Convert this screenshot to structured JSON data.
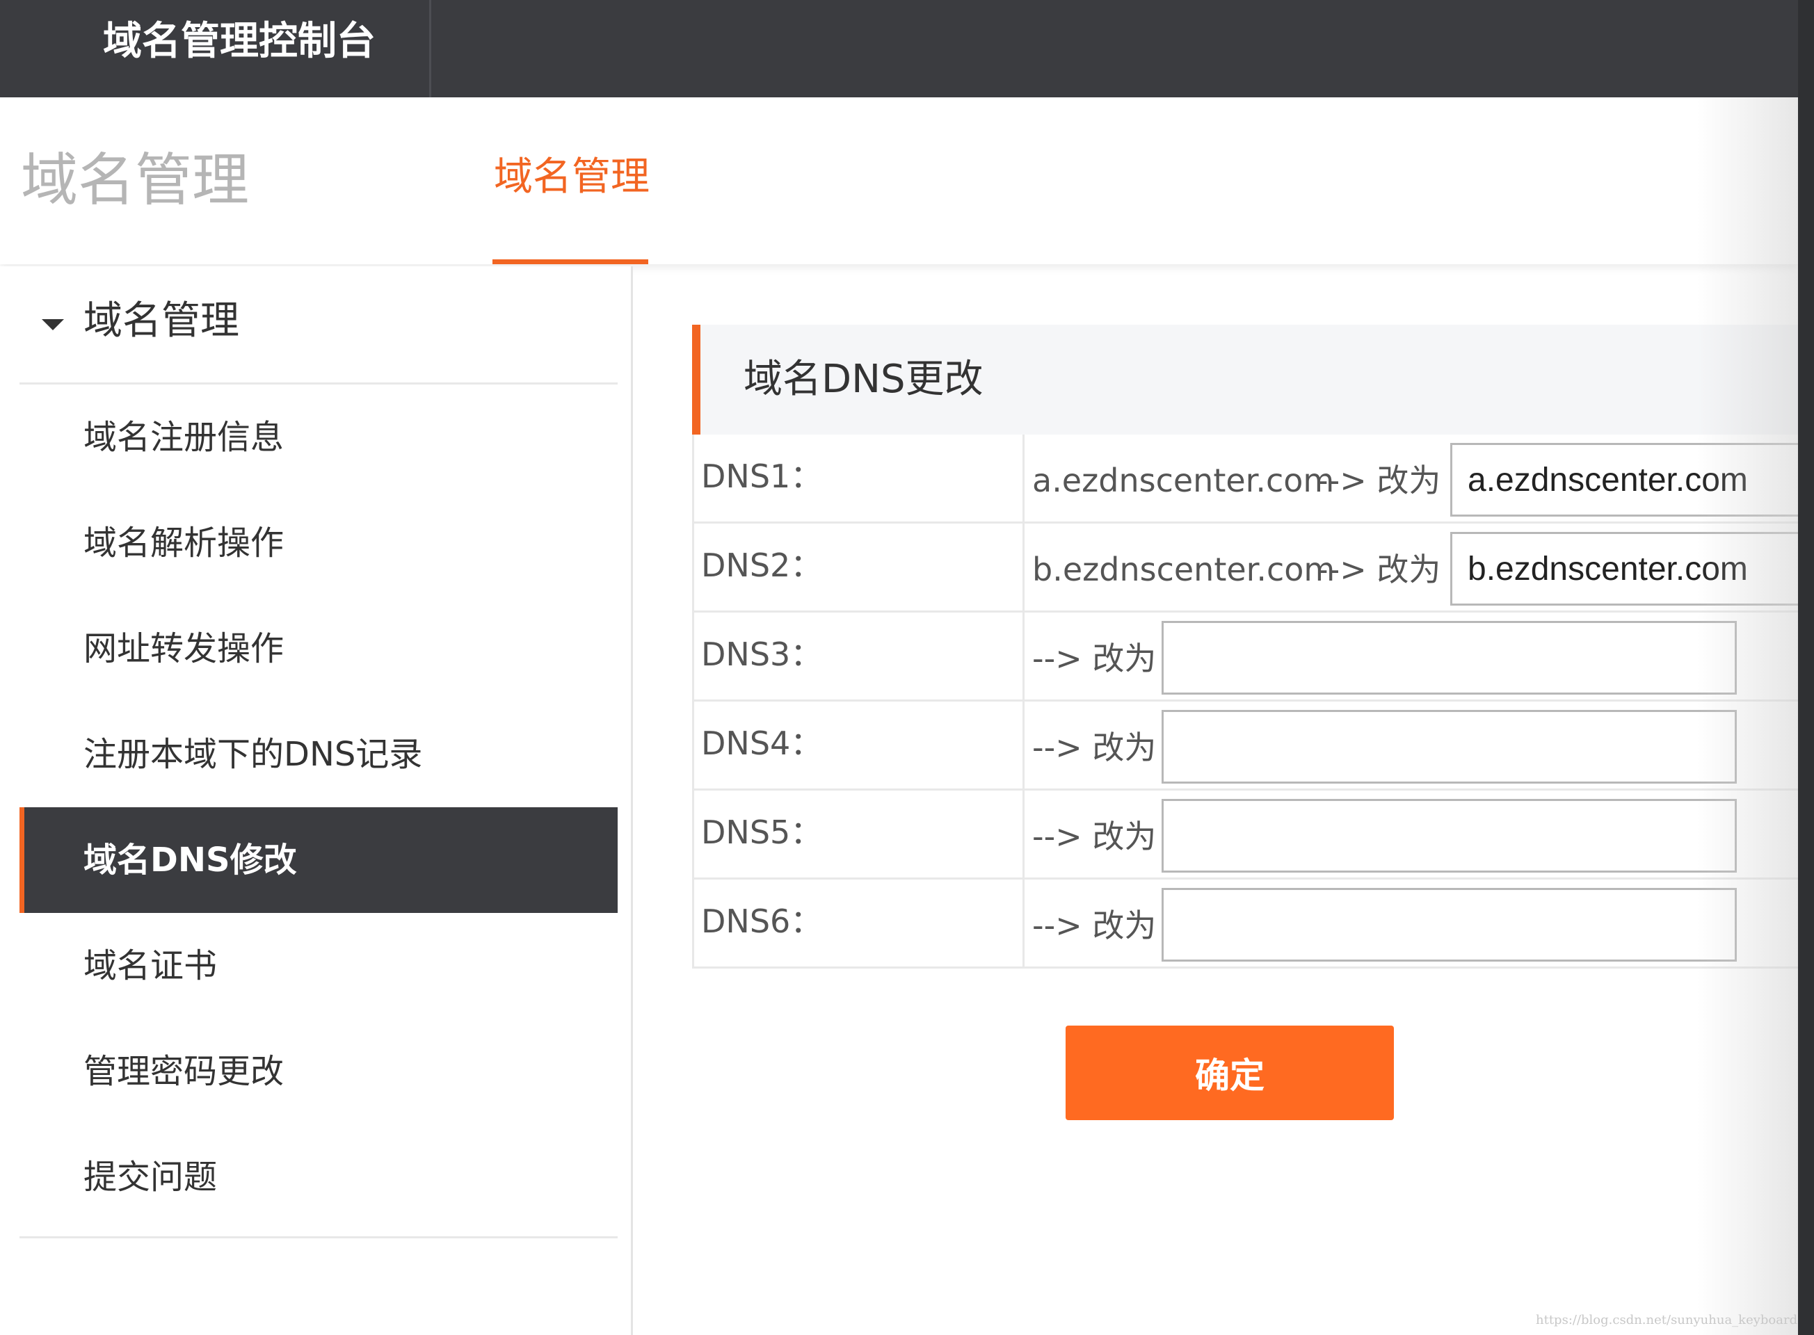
{
  "topbar": {
    "brand": "域名管理控制台"
  },
  "subheader": {
    "section_title": "域名管理",
    "tab_label": "域名管理"
  },
  "sidebar": {
    "header": "域名管理",
    "items": [
      {
        "label": "域名注册信息",
        "active": false
      },
      {
        "label": "域名解析操作",
        "active": false
      },
      {
        "label": "网址转发操作",
        "active": false
      },
      {
        "label": "注册本域下的DNS记录",
        "active": false
      },
      {
        "label": "域名DNS修改",
        "active": true
      },
      {
        "label": "域名证书",
        "active": false
      },
      {
        "label": "管理密码更改",
        "active": false
      },
      {
        "label": "提交问题",
        "active": false
      }
    ]
  },
  "panel": {
    "title": "域名DNS更改"
  },
  "dns_rows": [
    {
      "label": "DNS1：",
      "current": "a.ezdnscenter.com",
      "arrow": "--> 改为",
      "new_value": "a.ezdnscenter.com"
    },
    {
      "label": "DNS2：",
      "current": "b.ezdnscenter.com",
      "arrow": "--> 改为",
      "new_value": "b.ezdnscenter.com"
    },
    {
      "label": "DNS3：",
      "current": "",
      "arrow": "--> 改为",
      "new_value": ""
    },
    {
      "label": "DNS4：",
      "current": "",
      "arrow": "--> 改为",
      "new_value": ""
    },
    {
      "label": "DNS5：",
      "current": "",
      "arrow": "--> 改为",
      "new_value": ""
    },
    {
      "label": "DNS6：",
      "current": "",
      "arrow": "--> 改为",
      "new_value": ""
    }
  ],
  "confirm_label": "确定",
  "watermark": "https://blog.csdn.net/sunyuhua_keyboard",
  "colors": {
    "accent": "#f26522",
    "button": "#ff6a21",
    "topbar": "#3b3c40",
    "active_item": "#3b3c40"
  }
}
